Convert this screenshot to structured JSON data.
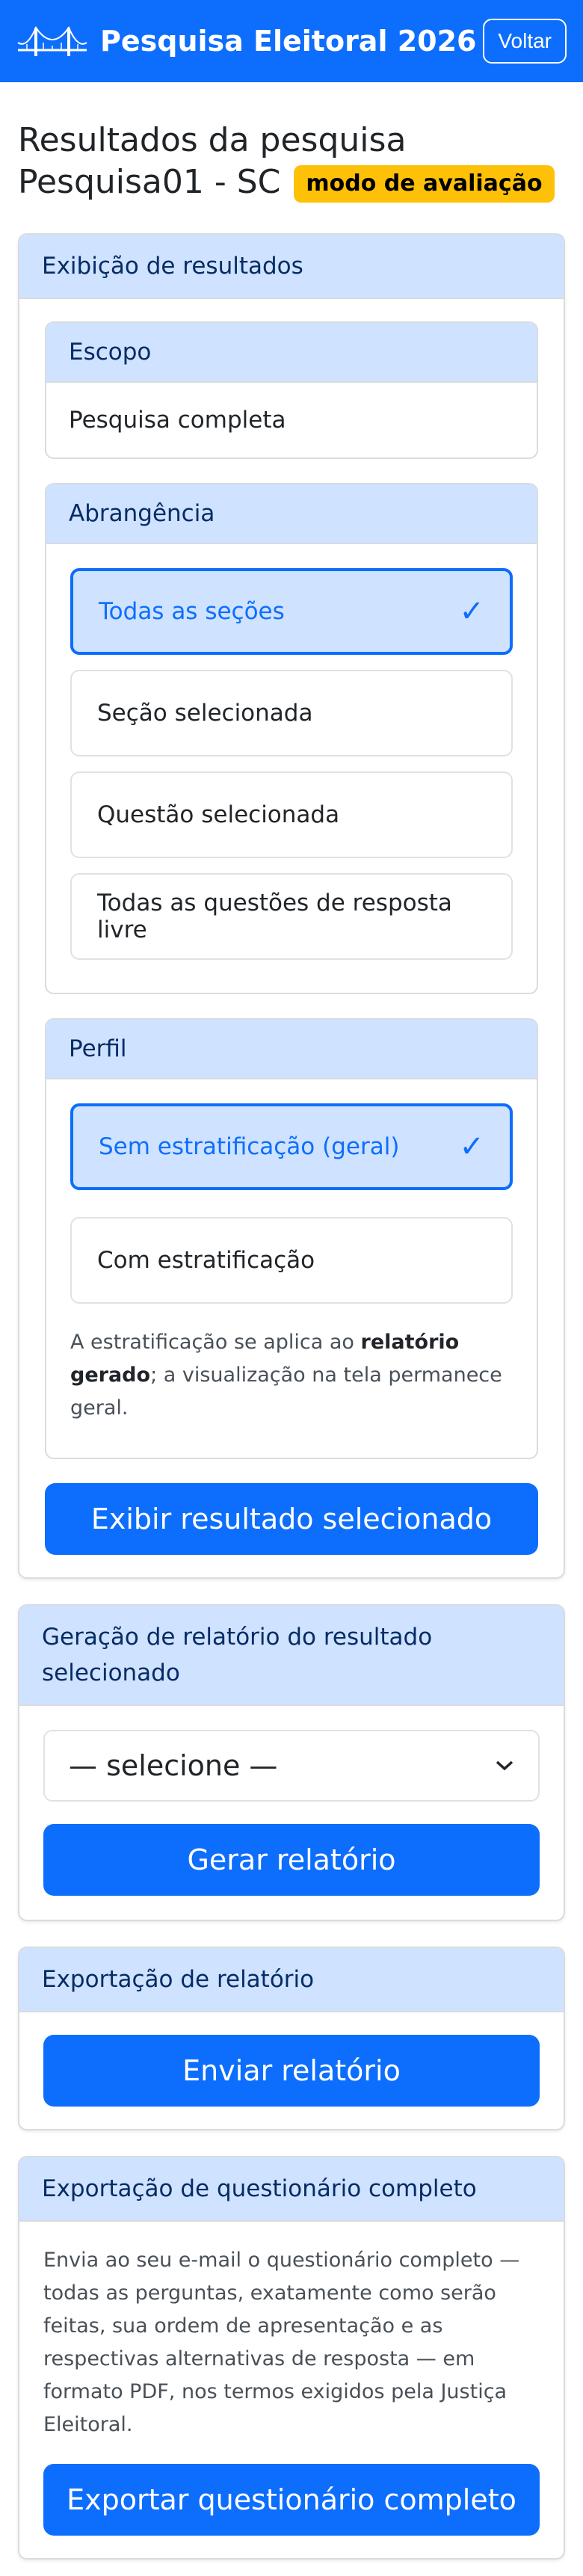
{
  "app": {
    "title": "Pesquisa Eleitoral 2026",
    "back_label": "Voltar"
  },
  "page": {
    "title": "Resultados da pesquisa Pesquisa01 - SC",
    "badge": "modo de avaliação"
  },
  "results_display": {
    "header": "Exibição de resultados",
    "scope": {
      "header": "Escopo",
      "value": "Pesquisa completa"
    },
    "coverage": {
      "header": "Abrangência",
      "options": [
        {
          "label": "Todas as seções",
          "selected": true
        },
        {
          "label": "Seção selecionada",
          "selected": false
        },
        {
          "label": "Questão selecionada",
          "selected": false
        },
        {
          "label": "Todas as questões de resposta livre",
          "selected": false
        }
      ]
    },
    "profile": {
      "header": "Perfil",
      "options": [
        {
          "label": "Sem estratificação (geral)",
          "selected": true
        },
        {
          "label": "Com estratificação",
          "selected": false
        }
      ],
      "note_prefix": "A estratificação se aplica ao ",
      "note_bold": "relatório gerado",
      "note_suffix": "; a visualização na tela permanece geral."
    },
    "button": "Exibir resultado selecionado"
  },
  "report_generation": {
    "header": "Geração de relatório do resultado selecionado",
    "select_value": "— selecione —",
    "button": "Gerar relatório"
  },
  "report_export": {
    "header": "Exportação de relatório",
    "button": "Enviar relatório"
  },
  "questionnaire_export": {
    "header": "Exportação de questionário completo",
    "description": "Envia ao seu e-mail o questionário completo — todas as perguntas, exatamente como serão feitas, sua ordem de apresentação e as respectivas alternativas de resposta — em formato PDF, nos termos exigidos pela Justiça Eleitoral.",
    "button": "Exportar questionário completo"
  },
  "icons": {
    "logo": "bridge-icon",
    "check": "check-icon",
    "dropdown": "chevron-down-icon"
  },
  "colors": {
    "primary": "#0d6efd",
    "header_bg": "#cfe2ff",
    "badge": "#ffc107"
  }
}
